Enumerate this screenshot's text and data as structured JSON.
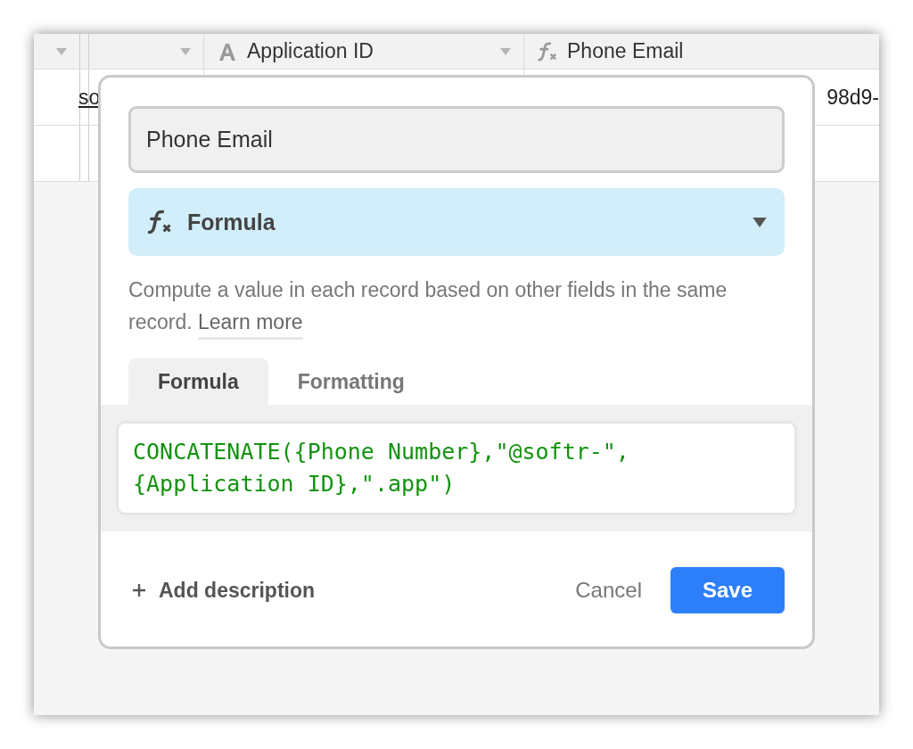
{
  "grid": {
    "columns": [
      {
        "kind": "blank",
        "dropdown": true
      },
      {
        "kind": "blank",
        "dropdown": true
      },
      {
        "kind": "text",
        "label": "Application ID",
        "dropdown": true
      },
      {
        "kind": "formula",
        "label": "Phone Email",
        "dropdown": false
      }
    ],
    "row": {
      "column_2": {
        "text": "so",
        "link": true
      },
      "column_4": "98d9-"
    }
  },
  "dialog": {
    "name_field": {
      "value": "Phone Email"
    },
    "type_select": {
      "kind": "formula",
      "label": "Formula"
    },
    "description": "Compute a value in each record based on other fields in the same record.",
    "learn_more": "Learn more",
    "tabs": [
      {
        "label": "Formula",
        "selected": true
      },
      {
        "label": "Formatting",
        "selected": false
      }
    ],
    "formula_lines": [
      "CONCATENATE({Phone Number},\"@softr-\",",
      "{Application ID},\".app\")"
    ],
    "add_description": "Add description",
    "buttons": {
      "cancel": "Cancel",
      "save": "Save"
    }
  }
}
